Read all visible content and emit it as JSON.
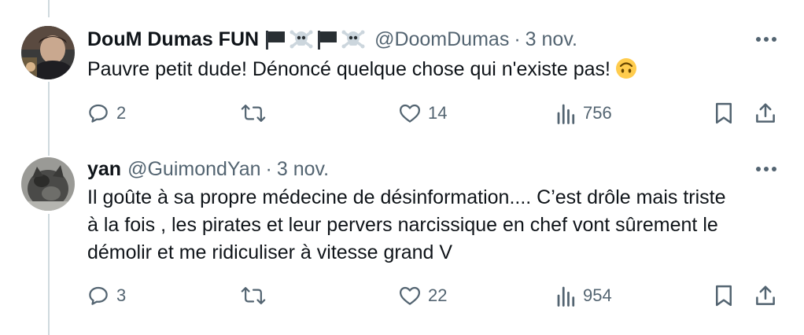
{
  "tweets": [
    {
      "display_name": "DouM Dumas FUN",
      "name_emojis": [
        "black-flag",
        "skull-and-crossbones",
        "black-flag",
        "skull-and-crossbones"
      ],
      "handle": "@DoomDumas",
      "separator": "·",
      "date": "3 nov.",
      "text_lines": [
        "Pauvre petit dude! Dénoncé quelque chose qui n'existe pas!"
      ],
      "text_emoji": "upside-down-face",
      "replies": "2",
      "retweets": "",
      "likes": "14",
      "views": "756"
    },
    {
      "display_name": "yan",
      "handle": "@GuimondYan",
      "separator": "·",
      "date": "3 nov.",
      "text_lines": [
        "Il goûte à sa propre médecine de désinformation.... C’est drôle mais triste",
        "à la fois , les pirates et leur pervers narcissique en chef vont sûrement le",
        "démolir et me ridiculiser à vitesse grand V"
      ],
      "replies": "3",
      "retweets": "",
      "likes": "22",
      "views": "954"
    }
  ],
  "colors": {
    "text": "#0f1419",
    "secondary": "#536471",
    "thread_line": "#cfd9de"
  }
}
